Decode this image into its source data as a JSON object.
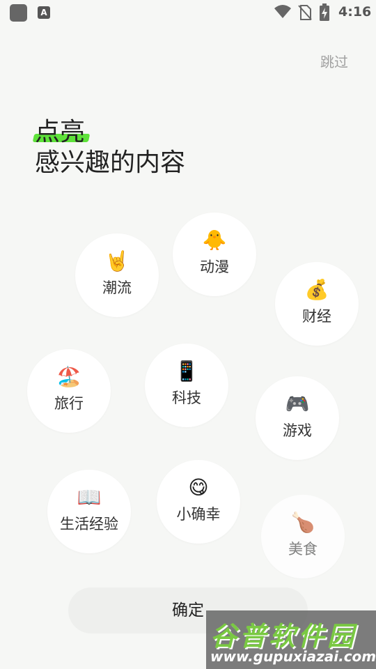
{
  "status_bar": {
    "time": "4:16",
    "icons": [
      "app-icon",
      "accessibility-icon",
      "wifi-icon",
      "no-sim-icon",
      "battery-charging-icon"
    ],
    "accessibility_glyph": "A"
  },
  "header": {
    "skip_label": "跳过",
    "title_line1": "点亮",
    "title_line2": "感兴趣的内容",
    "highlight_color": "#5ee23a"
  },
  "interests": [
    {
      "emoji": "🤘",
      "label": "潮流"
    },
    {
      "emoji": "🐥",
      "label": "动漫"
    },
    {
      "emoji": "💰",
      "label": "财经"
    },
    {
      "emoji": "🏖️",
      "label": "旅行"
    },
    {
      "emoji": "📱",
      "label": "科技"
    },
    {
      "emoji": "🎮",
      "label": "游戏"
    },
    {
      "emoji": "📖",
      "label": "生活经验"
    },
    {
      "emoji": "😋",
      "label": "小确幸"
    },
    {
      "emoji": "🍗",
      "label": "美食"
    }
  ],
  "confirm_label": "确定",
  "watermark": {
    "name": "谷普软件园",
    "url": "www.gupuxiazai.com"
  },
  "colors": {
    "background": "#f6f7f5",
    "bubble": "#ffffff",
    "button": "#eeefed",
    "accent": "#5ee23a"
  }
}
